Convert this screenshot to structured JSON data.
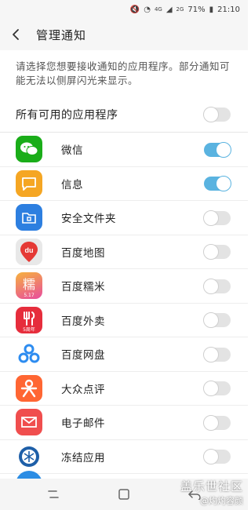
{
  "status_bar": {
    "signal_label": "4G",
    "secondary_signal": "2G",
    "battery": "71%",
    "time": "21:10"
  },
  "header": {
    "title": "管理通知"
  },
  "description": "请选择您想要接收通知的应用程序。部分通知可能无法以侧屏闪光来显示。",
  "all_apps": {
    "label": "所有可用的应用程序",
    "enabled": false
  },
  "apps": [
    {
      "name": "微信",
      "enabled": true,
      "icon": "wechat-icon",
      "color": "#1aad19"
    },
    {
      "name": "信息",
      "enabled": true,
      "icon": "messages-icon",
      "color": "#f5a623"
    },
    {
      "name": "安全文件夹",
      "enabled": false,
      "icon": "secure-folder-icon",
      "color": "#2d7fe0"
    },
    {
      "name": "百度地图",
      "enabled": false,
      "icon": "baidu-map-icon",
      "color": "#e8e8e8",
      "icon_text": "du"
    },
    {
      "name": "百度糯米",
      "enabled": false,
      "icon": "baidu-nuomi-icon",
      "color": "#e84c9e",
      "icon_text": "糯",
      "icon_subtext": "5.17"
    },
    {
      "name": "百度外卖",
      "enabled": false,
      "icon": "baidu-waimai-icon",
      "color": "#e62d3c",
      "icon_subtext": "5周年"
    },
    {
      "name": "百度网盘",
      "enabled": false,
      "icon": "baidu-netdisk-icon",
      "color": "#ffffff"
    },
    {
      "name": "大众点评",
      "enabled": false,
      "icon": "dianping-icon",
      "color": "#ff6633"
    },
    {
      "name": "电子邮件",
      "enabled": false,
      "icon": "email-icon",
      "color": "#f04e4e"
    },
    {
      "name": "冻结应用",
      "enabled": false,
      "icon": "freeze-app-icon",
      "color": "#ffffff"
    }
  ],
  "watermark": {
    "line1": "盖乐世社区",
    "line2": "@灼灼容颜"
  },
  "colors": {
    "toggle_on": "#5ab3e0",
    "toggle_off": "#e3e3e3"
  }
}
